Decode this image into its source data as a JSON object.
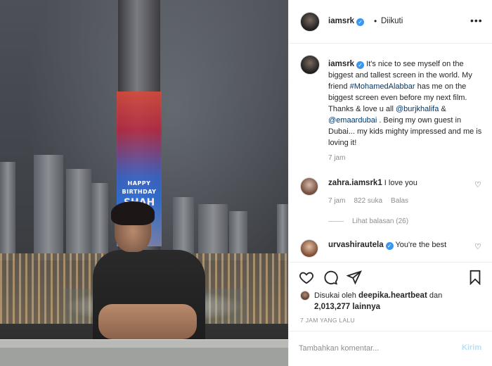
{
  "photo": {
    "screen_lines": [
      "HAPPY",
      "BIRTHDAY",
      "SHAH"
    ]
  },
  "header": {
    "username": "iamsrk",
    "dot": "•",
    "follow_status": "Diikuti",
    "more_icon": "more-horizontal-icon"
  },
  "caption": {
    "username": "iamsrk",
    "part1": " It's nice to see myself on the biggest and tallest screen in the world. My friend ",
    "hashtag": "#MohamedAlabbar",
    "part2": " has me on the biggest screen even before my next film. Thanks & love u all ",
    "mention1": "@burjkhalifa",
    "part3": " & ",
    "mention2": "@emaardubai",
    "part4": " . Being my own guest in Dubai... my kids mighty impressed and me is loving it!",
    "time": "7 jam"
  },
  "comments": [
    {
      "username": "zahra.iamsrk1",
      "text": " I love you",
      "time": "7 jam",
      "likes": "822 suka",
      "reply_label": "Balas",
      "replies_label": "Lihat balasan (26)"
    },
    {
      "username": "urvashirautela",
      "text": " You're the best"
    }
  ],
  "likes": {
    "prefix": "Disukai oleh ",
    "user": "deepika.heartbeat",
    "mid": " dan ",
    "count": "2,013,277",
    "suffix": " lainnya"
  },
  "post_date": "7 JAM YANG LALU",
  "comment_box": {
    "placeholder": "Tambahkan komentar...",
    "send_label": "Kirim"
  },
  "colors": {
    "verified": "#3897f0",
    "link": "#00376b",
    "send_disabled": "#b2dffc"
  }
}
